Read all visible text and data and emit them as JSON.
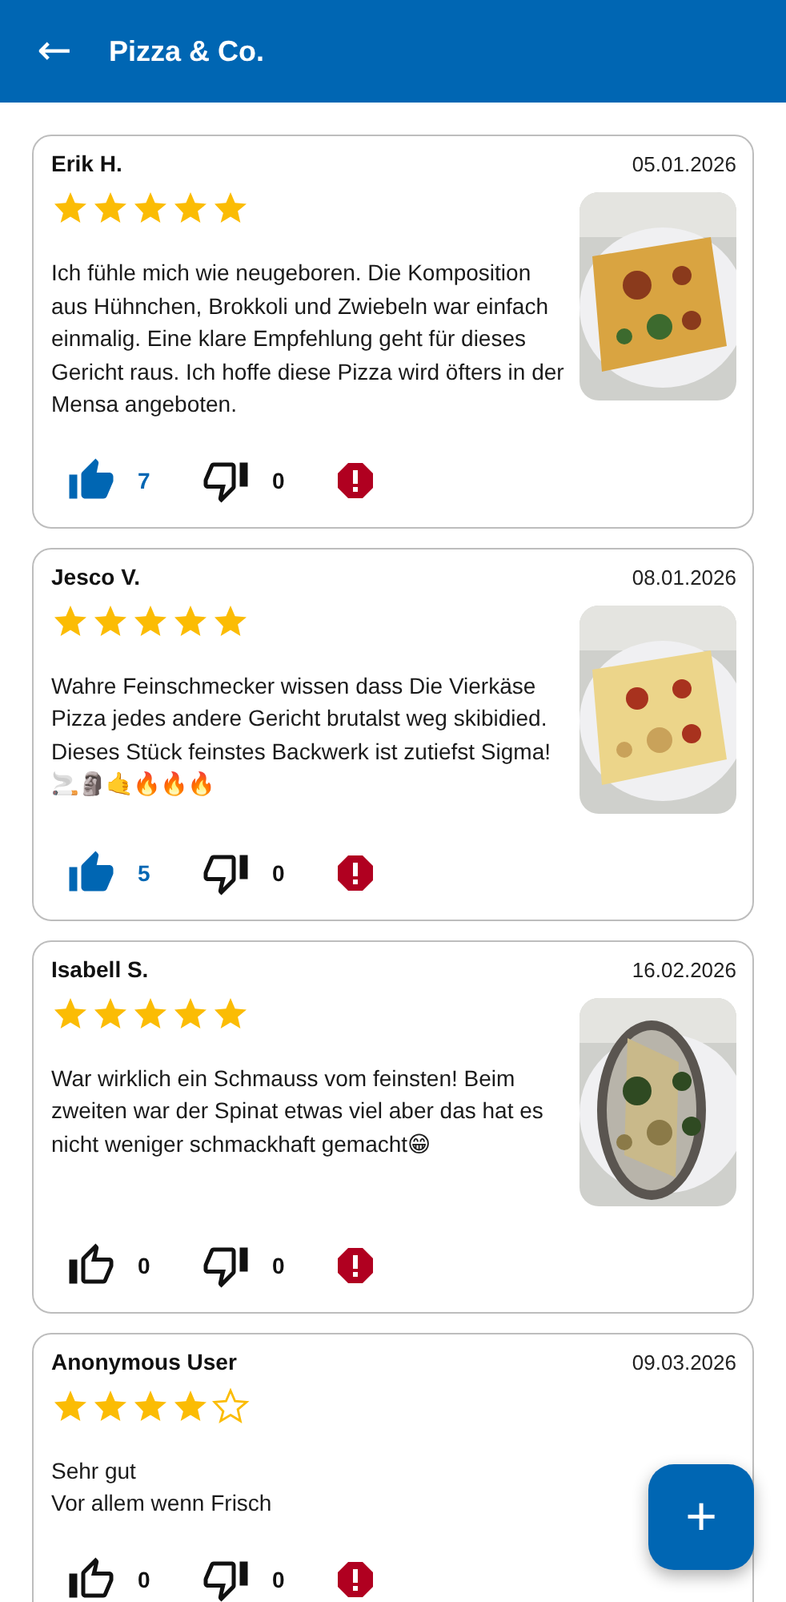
{
  "app_bar": {
    "back": "←",
    "title": "Pizza & Co."
  },
  "reviews": [
    {
      "author": "Erik H.",
      "date": "05.01.2026",
      "stars": 5,
      "text": "Ich fühle mich wie neugeboren. Die Komposition aus Hühnchen, Brokkoli und Zwiebeln war einfach einmalig. Eine klare Empfehlung geht für dieses Gericht raus. Ich hoffe diese Pizza wird öfters in der Mensa angeboten.",
      "liked": true,
      "likes": "7",
      "disliked": false,
      "dislikes": "0"
    },
    {
      "author": "Jesco V.",
      "date": "08.01.2026",
      "stars": 5,
      "text": "Wahre Feinschmecker wissen dass Die Vierkäse Pizza jedes andere Gericht brutalst weg skibidied. Dieses Stück feinstes Backwerk ist zutiefst Sigma! 🚬🗿🤙🔥🔥🔥",
      "liked": true,
      "likes": "5",
      "disliked": false,
      "dislikes": "0"
    },
    {
      "author": "Isabell S.",
      "date": "16.02.2026",
      "stars": 5,
      "text": "War wirklich ein Schmauss vom feinsten! Beim zweiten war der Spinat etwas viel aber das hat es nicht weniger schmackhaft gemacht😁",
      "liked": false,
      "likes": "0",
      "disliked": false,
      "dislikes": "0"
    },
    {
      "author": "Anonymous User",
      "date": "09.03.2026",
      "stars": 4,
      "text": "Sehr gut\nVor allem wenn Frisch",
      "liked": false,
      "likes": "0",
      "disliked": false,
      "dislikes": "0"
    }
  ],
  "fab": "+"
}
